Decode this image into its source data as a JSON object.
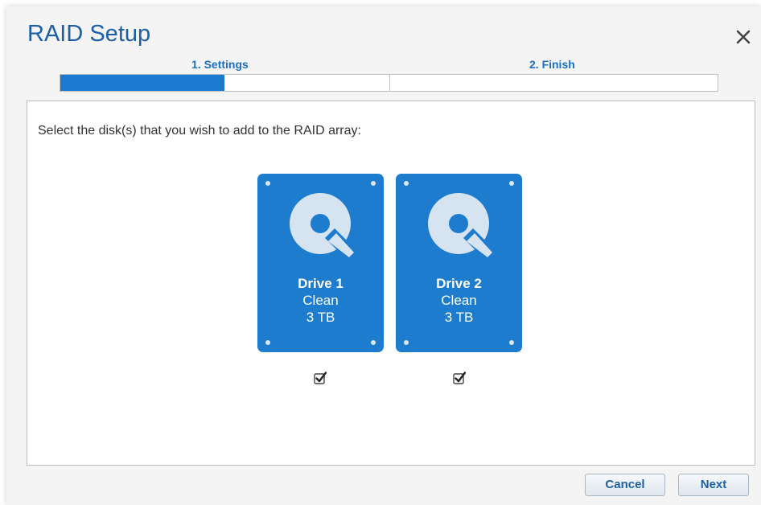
{
  "dialog": {
    "title": "RAID Setup"
  },
  "steps": [
    {
      "label": "1. Settings",
      "active": true
    },
    {
      "label": "2. Finish",
      "active": false
    }
  ],
  "progress": {
    "fraction": 0.25
  },
  "instruction": "Select the disk(s) that you wish to add to the RAID array:",
  "drives": [
    {
      "name": "Drive 1",
      "status": "Clean",
      "size": "3 TB",
      "checked": true
    },
    {
      "name": "Drive 2",
      "status": "Clean",
      "size": "3 TB",
      "checked": true
    }
  ],
  "buttons": {
    "cancel": "Cancel",
    "next": "Next"
  },
  "icons": {
    "close": "close-icon",
    "disk": "hard-disk-icon",
    "checkbox": "checkbox-checked-icon"
  },
  "colors": {
    "accent": "#1e7ccf",
    "title": "#1c5fa8"
  }
}
